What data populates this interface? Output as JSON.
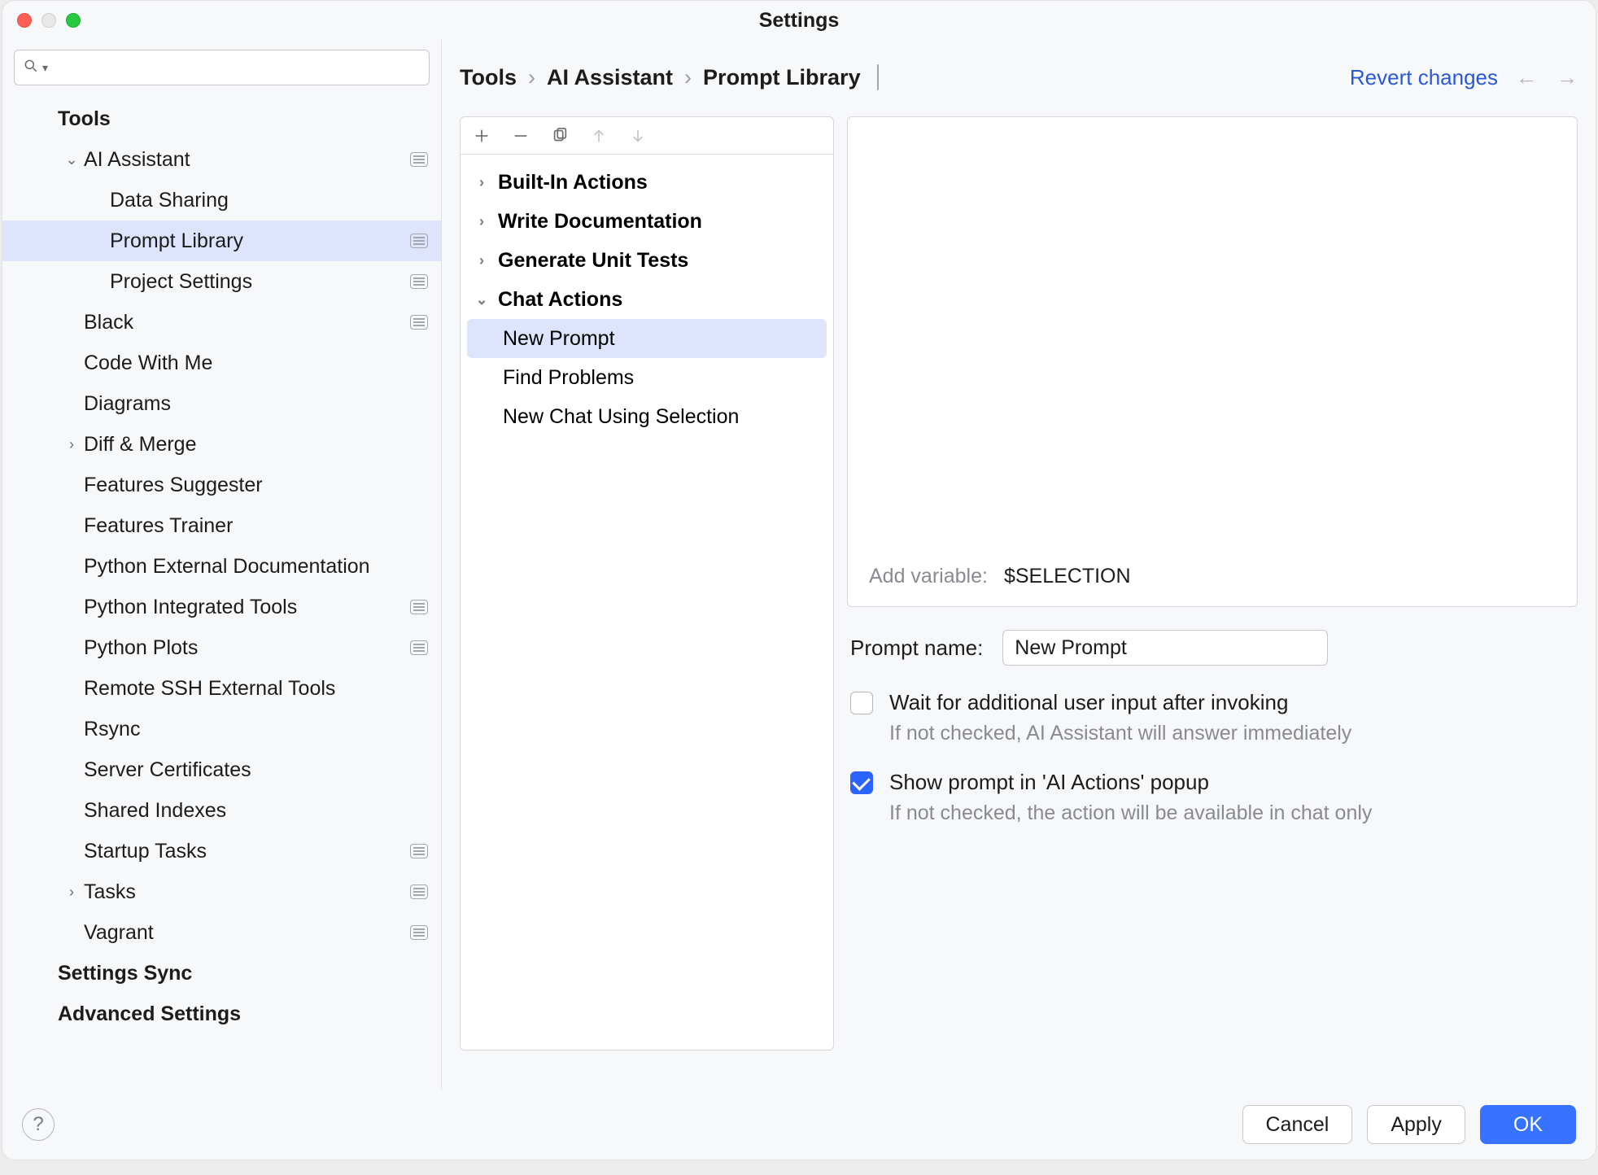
{
  "window_title": "Settings",
  "search_placeholder": "",
  "sidebar": {
    "items": [
      {
        "label": "Tools",
        "depth": 0,
        "bold": true,
        "chevron": "",
        "scope": false,
        "selected": false
      },
      {
        "label": "AI Assistant",
        "depth": 1,
        "bold": false,
        "chevron": "down",
        "scope": true,
        "selected": false
      },
      {
        "label": "Data Sharing",
        "depth": 2,
        "bold": false,
        "chevron": "",
        "scope": false,
        "selected": false
      },
      {
        "label": "Prompt Library",
        "depth": 2,
        "bold": false,
        "chevron": "",
        "scope": true,
        "selected": true
      },
      {
        "label": "Project Settings",
        "depth": 2,
        "bold": false,
        "chevron": "",
        "scope": true,
        "selected": false
      },
      {
        "label": "Black",
        "depth": 1,
        "bold": false,
        "chevron": "",
        "scope": true,
        "selected": false
      },
      {
        "label": "Code With Me",
        "depth": 1,
        "bold": false,
        "chevron": "",
        "scope": false,
        "selected": false
      },
      {
        "label": "Diagrams",
        "depth": 1,
        "bold": false,
        "chevron": "",
        "scope": false,
        "selected": false
      },
      {
        "label": "Diff & Merge",
        "depth": 1,
        "bold": false,
        "chevron": "right",
        "scope": false,
        "selected": false
      },
      {
        "label": "Features Suggester",
        "depth": 1,
        "bold": false,
        "chevron": "",
        "scope": false,
        "selected": false
      },
      {
        "label": "Features Trainer",
        "depth": 1,
        "bold": false,
        "chevron": "",
        "scope": false,
        "selected": false
      },
      {
        "label": "Python External Documentation",
        "depth": 1,
        "bold": false,
        "chevron": "",
        "scope": false,
        "selected": false
      },
      {
        "label": "Python Integrated Tools",
        "depth": 1,
        "bold": false,
        "chevron": "",
        "scope": true,
        "selected": false
      },
      {
        "label": "Python Plots",
        "depth": 1,
        "bold": false,
        "chevron": "",
        "scope": true,
        "selected": false
      },
      {
        "label": "Remote SSH External Tools",
        "depth": 1,
        "bold": false,
        "chevron": "",
        "scope": false,
        "selected": false
      },
      {
        "label": "Rsync",
        "depth": 1,
        "bold": false,
        "chevron": "",
        "scope": false,
        "selected": false
      },
      {
        "label": "Server Certificates",
        "depth": 1,
        "bold": false,
        "chevron": "",
        "scope": false,
        "selected": false
      },
      {
        "label": "Shared Indexes",
        "depth": 1,
        "bold": false,
        "chevron": "",
        "scope": false,
        "selected": false
      },
      {
        "label": "Startup Tasks",
        "depth": 1,
        "bold": false,
        "chevron": "",
        "scope": true,
        "selected": false
      },
      {
        "label": "Tasks",
        "depth": 1,
        "bold": false,
        "chevron": "right",
        "scope": true,
        "selected": false
      },
      {
        "label": "Vagrant",
        "depth": 1,
        "bold": false,
        "chevron": "",
        "scope": true,
        "selected": false
      },
      {
        "label": "Settings Sync",
        "depth": 0,
        "bold": true,
        "chevron": "",
        "scope": false,
        "selected": false
      },
      {
        "label": "Advanced Settings",
        "depth": 0,
        "bold": true,
        "chevron": "",
        "scope": false,
        "selected": false
      }
    ]
  },
  "breadcrumb": {
    "a": "Tools",
    "b": "AI Assistant",
    "c": "Prompt Library"
  },
  "revert_label": "Revert changes",
  "prompt_tree": {
    "items": [
      {
        "label": "Built-In Actions",
        "bold": true,
        "chevron": "right",
        "indent": 0,
        "selected": false
      },
      {
        "label": "Write Documentation",
        "bold": true,
        "chevron": "right",
        "indent": 0,
        "selected": false
      },
      {
        "label": "Generate Unit Tests",
        "bold": true,
        "chevron": "right",
        "indent": 0,
        "selected": false
      },
      {
        "label": "Chat Actions",
        "bold": true,
        "chevron": "down",
        "indent": 0,
        "selected": false
      },
      {
        "label": "New Prompt",
        "bold": false,
        "chevron": "",
        "indent": 1,
        "selected": true
      },
      {
        "label": "Find Problems",
        "bold": false,
        "chevron": "",
        "indent": 1,
        "selected": false
      },
      {
        "label": "New Chat Using Selection",
        "bold": false,
        "chevron": "",
        "indent": 1,
        "selected": false
      }
    ]
  },
  "editor": {
    "add_variable_label": "Add variable:",
    "add_variable_value": "$SELECTION"
  },
  "form": {
    "prompt_name_label": "Prompt name:",
    "prompt_name_value": "New Prompt",
    "wait_label": "Wait for additional user input after invoking",
    "wait_hint": "If not checked, AI Assistant will answer immediately",
    "wait_checked": false,
    "show_label": "Show prompt in 'AI Actions' popup",
    "show_hint": "If not checked, the action will be available in chat only",
    "show_checked": true
  },
  "footer": {
    "cancel": "Cancel",
    "apply": "Apply",
    "ok": "OK"
  }
}
